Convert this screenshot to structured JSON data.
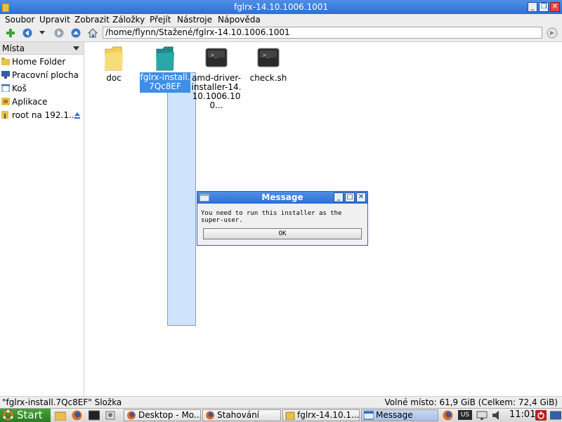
{
  "window": {
    "title": "fglrx-14.10.1006.1001",
    "buttons": [
      "minimize-icon",
      "maximize-icon",
      "close-icon"
    ]
  },
  "menubar": {
    "items": [
      {
        "label": "Soubor"
      },
      {
        "label": "Upravit"
      },
      {
        "label": "Zobrazit"
      },
      {
        "label": "Záložky"
      },
      {
        "label": "Přejít"
      },
      {
        "label": "Nástroje"
      },
      {
        "label": "Nápověda"
      }
    ]
  },
  "toolbar": {
    "location": "/home/flynn/Stažené/fglrx-14.10.1006.1001"
  },
  "sidebar": {
    "header": "Místa",
    "items": [
      {
        "label": "Home Folder",
        "icon": "home-folder-icon"
      },
      {
        "label": "Pracovní plocha",
        "icon": "desktop-icon"
      },
      {
        "label": "Koš",
        "icon": "trash-icon"
      },
      {
        "label": "Aplikace",
        "icon": "applications-icon"
      },
      {
        "label": "root na 192.1...",
        "icon": "network-folder-icon"
      }
    ]
  },
  "files": [
    {
      "label": "doc",
      "icon": "folder-icon"
    },
    {
      "label": "fglrx-install.7Qc8EF",
      "icon": "folder-icon",
      "selected": true
    },
    {
      "label": "amd-driver-installer-14.10.1006.100...",
      "icon": "script-icon"
    },
    {
      "label": "check.sh",
      "icon": "script-icon"
    }
  ],
  "statusbar": {
    "left": "\"fglrx-install.7Qc8EF\" Složka",
    "right": "Volné místo: 61,9 GiB (Celkem: 72,4 GiB)"
  },
  "dialog": {
    "title": "Message",
    "message": "You need to run this installer as the super-user.",
    "ok_label": "OK"
  },
  "taskbar": {
    "start_label": "Start",
    "tasks": [
      {
        "label": "Desktop - Mo..."
      },
      {
        "label": "Stahování"
      },
      {
        "label": "fglrx-14.10.1..."
      },
      {
        "label": "Message"
      }
    ],
    "keyboard_layout": "US",
    "clock": "11:01"
  },
  "colors": {
    "titlebar": "#2c6fd6",
    "selection": "#3d8ee6",
    "drag_rect": "#cfe3fa"
  }
}
